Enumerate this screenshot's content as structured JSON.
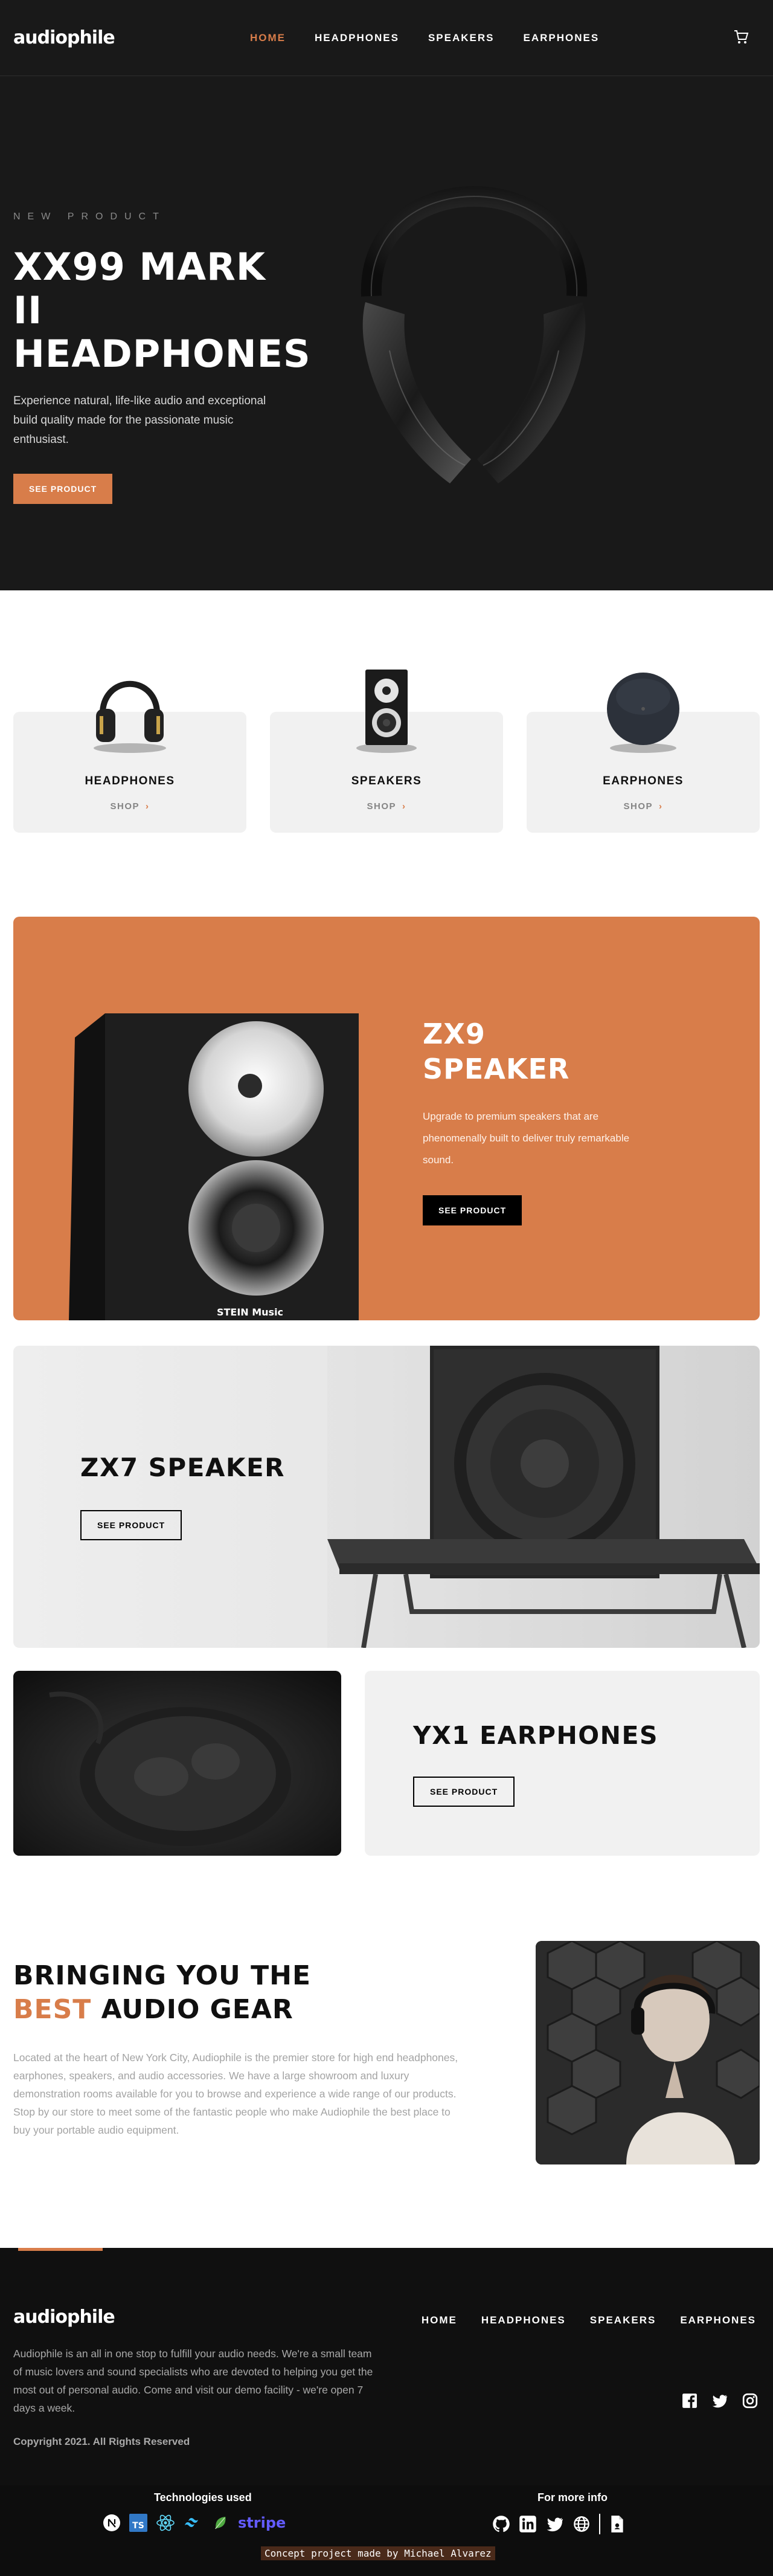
{
  "brand": "audiophile",
  "nav": [
    {
      "label": "HOME",
      "active": true
    },
    {
      "label": "HEADPHONES",
      "active": false
    },
    {
      "label": "SPEAKERS",
      "active": false
    },
    {
      "label": "EARPHONES",
      "active": false
    }
  ],
  "hero": {
    "overline": "NEW PRODUCT",
    "title_line1": "XX99 MARK II",
    "title_line2": "HEADPHONES",
    "description": "Experience natural, life-like audio and exceptional build quality made for the passionate music enthusiast.",
    "cta": "SEE PRODUCT"
  },
  "categories": [
    {
      "name": "HEADPHONES",
      "shop": "SHOP"
    },
    {
      "name": "SPEAKERS",
      "shop": "SHOP"
    },
    {
      "name": "EARPHONES",
      "shop": "SHOP"
    }
  ],
  "zx9": {
    "title_line1": "ZX9",
    "title_line2": "SPEAKER",
    "description": "Upgrade to premium speakers that are phenomenally built to deliver truly remarkable sound.",
    "cta": "SEE PRODUCT",
    "speaker_brand": "STEIN Music"
  },
  "zx7": {
    "title": "ZX7 SPEAKER",
    "cta": "SEE PRODUCT"
  },
  "yx1": {
    "title": "YX1 EARPHONES",
    "cta": "SEE PRODUCT"
  },
  "about": {
    "title_before": "BRINGING YOU THE",
    "title_accent": "BEST",
    "title_after": "AUDIO GEAR",
    "description": "Located at the heart of New York City, Audiophile is the premier store for high end headphones, earphones, speakers, and audio accessories. We have a large showroom and luxury demonstration rooms available for you to browse and experience a wide range of our products. Stop by our store to meet some of the fantastic people who make Audiophile the best place to buy your portable audio equipment."
  },
  "footer": {
    "logo": "audiophile",
    "nav": [
      "HOME",
      "HEADPHONES",
      "SPEAKERS",
      "EARPHONES"
    ],
    "description": "Audiophile is an all in one stop to fulfill your audio needs. We're a small team of music lovers and sound specialists who are devoted to helping you get the most out of personal audio. Come and visit our demo facility - we're open 7 days a week.",
    "copyright": "Copyright 2021. All Rights Reserved",
    "socials": [
      "facebook-icon",
      "twitter-icon",
      "instagram-icon"
    ]
  },
  "tech_bar": {
    "technologies_title": "Technologies used",
    "technologies": [
      "nextjs-icon",
      "typescript-icon",
      "react-icon",
      "tailwind-icon",
      "mongodb-icon",
      "stripe"
    ],
    "ts_label": "TS",
    "stripe_label": "stripe",
    "more_title": "For more info",
    "more_links": [
      "github-icon",
      "linkedin-icon",
      "twitter-icon",
      "globe-icon",
      "document-icon"
    ],
    "credit": "Concept project made by Michael Alvarez"
  },
  "colors": {
    "accent": "#d87d4a",
    "dark": "#191919",
    "light_gray": "#f1f1f1"
  }
}
